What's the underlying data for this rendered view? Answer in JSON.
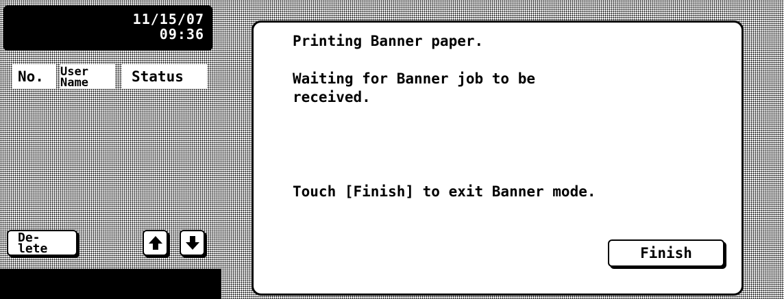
{
  "clock": {
    "date": "11/15/07",
    "time": "09:36"
  },
  "job_list": {
    "headers": {
      "number": "No.",
      "user_name_line1": "User",
      "user_name_line2": "Name",
      "status": "Status"
    }
  },
  "left_controls": {
    "delete_line1": "De-",
    "delete_line2": "lete",
    "scroll_up_icon": "arrow-up-icon",
    "scroll_down_icon": "arrow-down-icon"
  },
  "dialog": {
    "line1": "Printing Banner paper.",
    "line2": "Waiting for Banner job to be received.",
    "line3": "Touch [Finish] to exit Banner mode.",
    "finish_label": "Finish"
  }
}
